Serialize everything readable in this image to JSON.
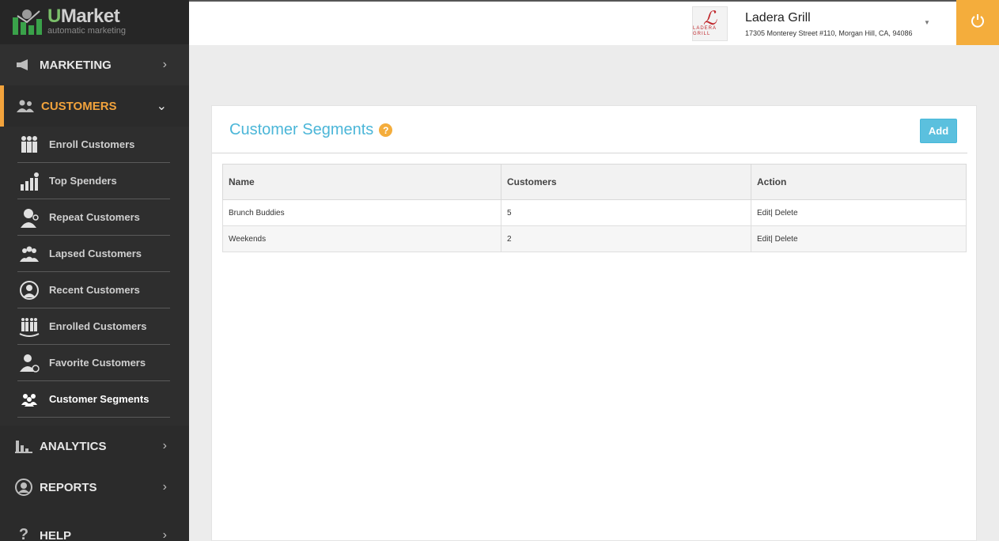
{
  "brand": {
    "name_u": "U",
    "name_rest": "Market",
    "tagline": "automatic marketing"
  },
  "sidebar": {
    "marketing": {
      "label": "MARKETING",
      "icon": "megaphone-icon"
    },
    "customers": {
      "label": "CUSTOMERS",
      "icon": "users-icon"
    },
    "sub_items": [
      {
        "label": "Enroll Customers",
        "icon": "group-icon"
      },
      {
        "label": "Top Spenders",
        "icon": "bar-person-icon"
      },
      {
        "label": "Repeat Customers",
        "icon": "repeat-person-icon"
      },
      {
        "label": "Lapsed Customers",
        "icon": "people-icon"
      },
      {
        "label": "Recent Customers",
        "icon": "headset-person-icon"
      },
      {
        "label": "Enrolled Customers",
        "icon": "crowd-icon"
      },
      {
        "label": "Favorite Customers",
        "icon": "person-heart-icon"
      },
      {
        "label": "Customer Segments",
        "icon": "segments-icon"
      }
    ],
    "analytics": {
      "label": "ANALYTICS",
      "icon": "chart-icon"
    },
    "reports": {
      "label": "REPORTS",
      "icon": "reports-icon"
    },
    "help": {
      "label": "HELP",
      "icon": "question-icon"
    }
  },
  "topbar": {
    "store_logo_text": "LADERA GRILL",
    "store_name": "Ladera Grill",
    "store_address": "17305 Monterey Street #110, Morgan Hill, CA, 94086"
  },
  "page": {
    "title": "Customer Segments",
    "add_label": "Add",
    "table": {
      "headers": [
        "Name",
        "Customers",
        "Action"
      ],
      "rows": [
        {
          "name": "Brunch Buddies",
          "customers": "5",
          "edit": "Edit",
          "delete": "| Delete"
        },
        {
          "name": "Weekends",
          "customers": "2",
          "edit": "Edit",
          "delete": "| Delete"
        }
      ]
    }
  },
  "colors": {
    "accent": "#f4ad3c",
    "title": "#4bb6d8",
    "add_button": "#5bc0de",
    "sidebar": "#2b2b2b"
  }
}
